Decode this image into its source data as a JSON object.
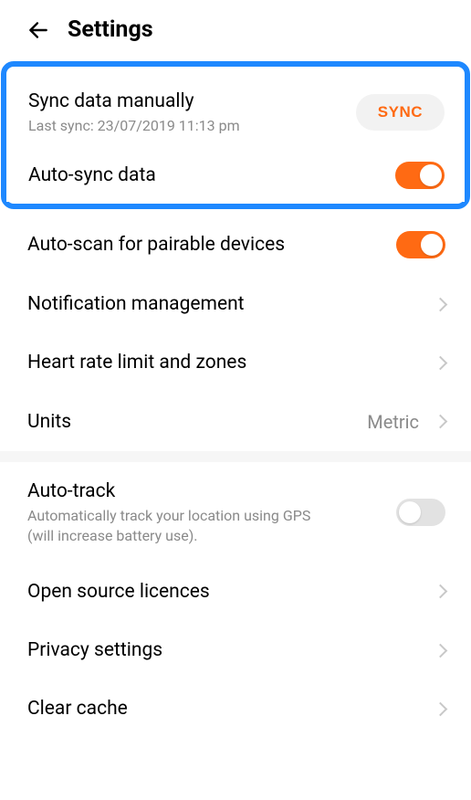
{
  "header": {
    "title": "Settings"
  },
  "sync": {
    "title": "Sync data manually",
    "sub": "Last sync: 23/07/2019 11:13 pm",
    "button": "SYNC"
  },
  "autoSync": {
    "title": "Auto-sync data"
  },
  "autoScan": {
    "title": "Auto-scan for pairable devices"
  },
  "notification": {
    "title": "Notification management"
  },
  "heartRate": {
    "title": "Heart rate limit and zones"
  },
  "units": {
    "title": "Units",
    "value": "Metric"
  },
  "autoTrack": {
    "title": "Auto-track",
    "sub": "Automatically track your location using GPS (will increase battery use)."
  },
  "openSource": {
    "title": "Open source licences"
  },
  "privacy": {
    "title": "Privacy settings"
  },
  "clearCache": {
    "title": "Clear cache"
  }
}
